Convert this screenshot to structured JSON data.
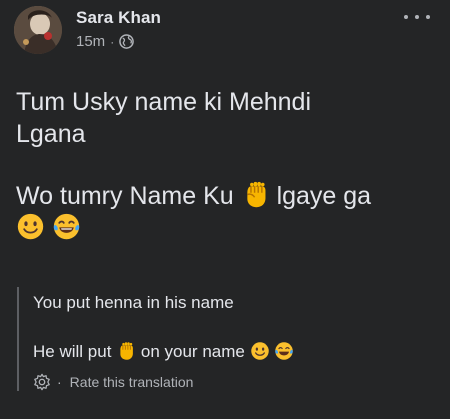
{
  "post": {
    "author": "Sara Khan",
    "time": "15m",
    "time_separator": "·",
    "privacy_icon": "globe-icon",
    "more_icon": "more-options-icon",
    "text_line_1a": "Tum Usky name ki Mehndi",
    "text_line_1b": "Lgana",
    "text_line_2a": "Wo tumry Name Ku",
    "text_line_2b": "lgaye ga",
    "emojis": [
      "raised-fist-emoji",
      "slightly-smiling-face-emoji",
      "face-with-tears-of-joy-emoji"
    ]
  },
  "translation": {
    "line_1": "You put henna in his name",
    "line_2a": "He will put",
    "line_2b": "on your name",
    "rate_separator": "·",
    "rate_label": "Rate this translation"
  },
  "colors": {
    "background": "#242526",
    "primary_text": "#e4e6eb",
    "secondary_text": "#b0b3b8",
    "quote_bar": "#5d5f63"
  }
}
